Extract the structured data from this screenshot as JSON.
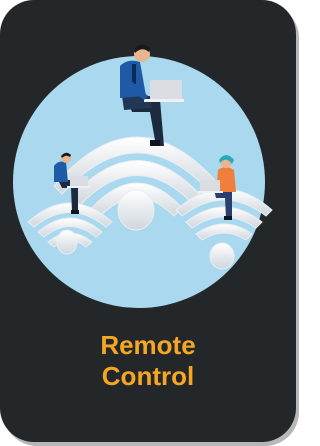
{
  "tile": {
    "label_line1": "Remote",
    "label_line2": "Control",
    "label_color": "#f5a623",
    "background_color": "#24272a",
    "circle_color": "#a9d8ef",
    "icon": "wifi-remote-workers-illustration"
  }
}
